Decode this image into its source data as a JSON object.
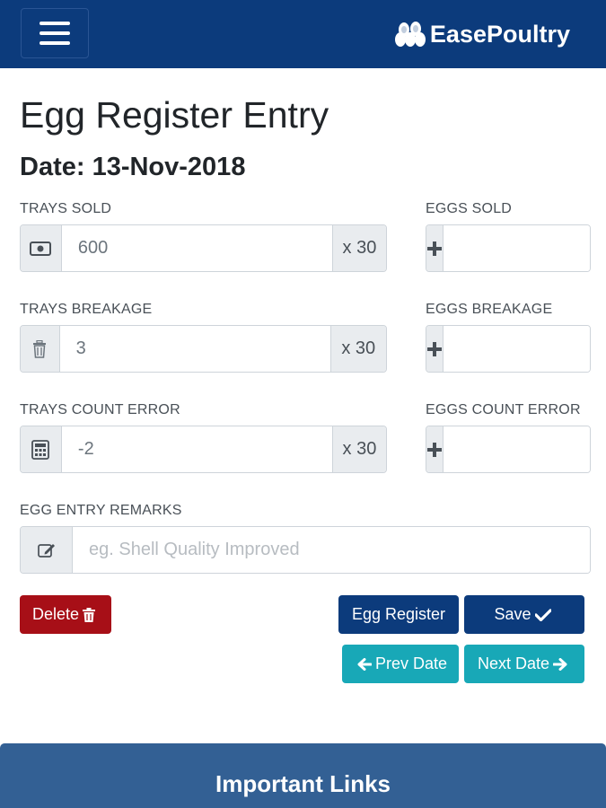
{
  "header": {
    "brand": "EasePoultry"
  },
  "page": {
    "title": "Egg Register Entry",
    "date_label": "Date: 13-Nov-2018"
  },
  "form": {
    "trays_sold": {
      "label": "TRAYS SOLD",
      "value": "600",
      "suffix": "x 30",
      "icon": "money-icon"
    },
    "eggs_sold": {
      "label": "EGGS SOLD",
      "value": "",
      "icon": "plus-icon"
    },
    "trays_breakage": {
      "label": "TRAYS BREAKAGE",
      "value": "3",
      "suffix": "x 30",
      "icon": "trash-icon"
    },
    "eggs_breakage": {
      "label": "EGGS BREAKAGE",
      "value": "",
      "icon": "plus-icon"
    },
    "trays_count_error": {
      "label": "TRAYS COUNT ERROR",
      "value": "-2",
      "suffix": "x 30",
      "icon": "calculator-icon"
    },
    "eggs_count_error": {
      "label": "EGGS COUNT ERROR",
      "value": "",
      "icon": "plus-icon"
    },
    "remarks": {
      "label": "EGG ENTRY REMARKS",
      "value": "",
      "placeholder": "eg. Shell Quality Improved",
      "icon": "edit-icon"
    }
  },
  "buttons": {
    "delete": "Delete",
    "egg_register": "Egg Register",
    "save": "Save",
    "prev_date": "Prev Date",
    "next_date": "Next Date"
  },
  "footer": {
    "title": "Important Links"
  },
  "colors": {
    "navbar": "#0c3b7c",
    "primary": "#0c3b7c",
    "danger": "#a70f17",
    "info": "#18a8b7",
    "footer": "#336094"
  }
}
